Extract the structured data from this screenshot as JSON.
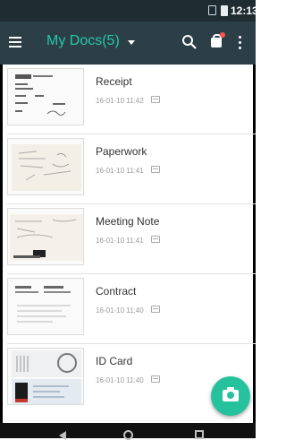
{
  "status_bar": {
    "time": "12:13",
    "icons": [
      "sim-icon",
      "battery-icon"
    ]
  },
  "app_bar": {
    "title": "My Docs(5)",
    "title_color": "#27c7a8",
    "background": "#2c3f47",
    "icons": [
      "menu-icon",
      "dropdown-caret-icon",
      "search-icon",
      "premium-icon",
      "more-vert-icon"
    ]
  },
  "documents": [
    {
      "name": "Receipt",
      "date": "16-01-10 11:42"
    },
    {
      "name": "Paperwork",
      "date": "16-01-10 11:41"
    },
    {
      "name": "Meeting Note",
      "date": "16-01-10 11:41"
    },
    {
      "name": "Contract",
      "date": "16-01-10 11:40"
    },
    {
      "name": "ID Card",
      "date": "16-01-10 11:40"
    }
  ],
  "fab": {
    "icon": "camera-icon",
    "color": "#26c29e"
  },
  "nav_bar": {
    "icons": [
      "back-icon",
      "home-icon",
      "recents-icon"
    ]
  }
}
